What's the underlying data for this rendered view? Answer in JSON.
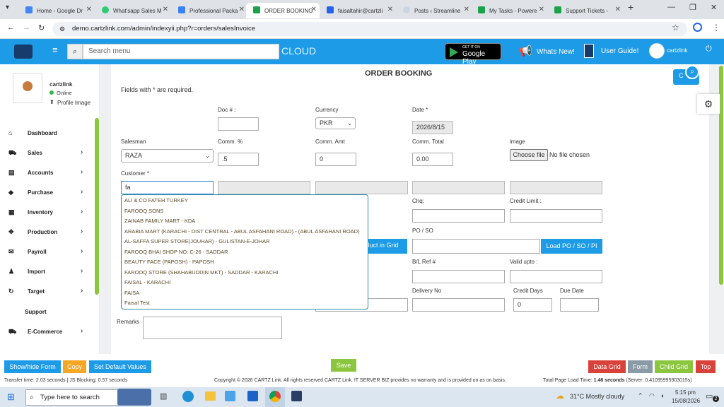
{
  "browser": {
    "tabs": [
      {
        "label": "Home - Google Dr",
        "color": "#4285f4"
      },
      {
        "label": "What'sapp Sales M",
        "color": "#2ecc71"
      },
      {
        "label": "Professional Packa",
        "color": "#3b82f6"
      },
      {
        "label": "ORDER BOOKING",
        "color": "#1aa34a"
      },
      {
        "label": "faisaltahir@cartzli",
        "color": "#2563eb"
      },
      {
        "label": "Posts ‹ Streamline",
        "color": "#e5e7eb"
      },
      {
        "label": "My Tasks - Powere",
        "color": "#1aa34a"
      },
      {
        "label": "Support Tickets -",
        "color": "#1aa34a"
      }
    ],
    "url": "demo.cartzlink.com/admin/indexyii.php?r=orders/salesInvoice"
  },
  "header": {
    "search_placeholder": "Search menu",
    "cloud_label": "CLOUD",
    "gplay_small": "GET IT ON",
    "gplay_big": "Google Play",
    "whats_new": "Whats New!",
    "user_guide": "User Guide!",
    "username": "cartzlink"
  },
  "profile": {
    "name": "cartzlink",
    "status": "Online",
    "profile_image": "Profile Image"
  },
  "sidebar": {
    "items": [
      {
        "label": "Dashboard",
        "icon": "home-icon",
        "glyph": "⌂",
        "arrow": false
      },
      {
        "label": "Sales",
        "icon": "cart-icon",
        "glyph": "🛒",
        "arrow": true
      },
      {
        "label": "Accounts",
        "icon": "bank-icon",
        "glyph": "▤",
        "arrow": true
      },
      {
        "label": "Purchase",
        "icon": "tag-icon",
        "glyph": "◆",
        "arrow": true
      },
      {
        "label": "Inventory",
        "icon": "grid-icon",
        "glyph": "▦",
        "arrow": true
      },
      {
        "label": "Production",
        "icon": "production-icon",
        "glyph": "✥",
        "arrow": true
      },
      {
        "label": "Payroll",
        "icon": "payroll-icon",
        "glyph": "✉",
        "arrow": true
      },
      {
        "label": "Import",
        "icon": "user-icon",
        "glyph": "♟",
        "arrow": true
      },
      {
        "label": "Target",
        "icon": "refresh-icon",
        "glyph": "↻",
        "arrow": true
      },
      {
        "label": "Support",
        "icon": "",
        "glyph": "",
        "arrow": false
      },
      {
        "label": "E-Commerce",
        "icon": "cart-icon",
        "glyph": "🛒",
        "arrow": true
      }
    ]
  },
  "form": {
    "title": "ORDER BOOKING",
    "required_note": "Fields with * are required.",
    "doc_label": "Doc # :",
    "doc_value": "",
    "currency_label": "Currency",
    "currency_value": "PKR",
    "date_label": "Date *",
    "date_value": "2026/8/15",
    "salesman_label": "Salesman",
    "salesman_value": "RAZA",
    "comm_pct_label": "Comm. %",
    "comm_pct_value": ".5",
    "comm_amt_label": "Comm. Amt",
    "comm_amt_value": "0",
    "comm_total_label": "Comm. Total",
    "comm_total_value": "0.00",
    "image_label": "image",
    "choose_file": "Choose file",
    "no_file": "No file chosen",
    "customer_label": "Customer *",
    "customer_value": "fa",
    "chq_label": "Chq:",
    "credit_limit_label": "Credit Limit :",
    "po_label": "PO / SO",
    "load_grid_btn": "oduct in Grid",
    "load_po_btn": "Load PO / SO / PI",
    "bl_ref_label": "B/L Ref #",
    "valid_upto_label": "Valid upto :",
    "delivery_label": "Delivery No",
    "credit_days_label": "Credit Days",
    "credit_days_value": "0",
    "due_date_label": "Due Date",
    "remarks_label": "Remarks"
  },
  "customer_suggestions": [
    "ALI & CO FATEH TURKEY",
    "FAROOQ SONS",
    "ZAINAB FAMILY MART - KDA",
    "ARABIA MART (KARACHI - DIST CENTRAL - ABUL ASFAHANI ROAD) - (ABUL ASFAHANI ROAD)",
    "AL-SAFFA SUPER STORE(JOUHAR) - GULISTAN-E-JOHAR",
    "FAROOQ BHAI SHOP NO: C-26 - SADDAR",
    "BEAUTY FACE (PAPOSH) - PAPOSH",
    "FAROOQ STORE (SHAHABUDDIN MKT) - SADDAR - KARACHI",
    "FAISAL - KARACHI",
    "FAISA",
    "Faisal Test"
  ],
  "bottom": {
    "showhide": "Show/hide Form",
    "copy": "Copy",
    "set_default": "Set Default Values",
    "save": "Save",
    "data_grid": "Data Grid",
    "form": "Form",
    "child_grid": "Child Grid",
    "top": "Top"
  },
  "footer": {
    "transfer": "Transfer time: 2.03 seconds | JS Blocking: 0.57 seconds",
    "copyright": "Copyright © 2026 CARTZ Link. All rights reserved CARTZ Link. IT SERVER BIZ provides no warranty and is provided on as on basis.",
    "load_prefix": "Total Page Load Time: ",
    "load_time": "1.46 seconds",
    "load_suffix": " (Server: 0.41095995903015s)"
  },
  "taskbar": {
    "search": "Type here to search",
    "weather": "31°C  Mostly cloudy",
    "time": "5:15 pm",
    "date": "15/08/2026",
    "notif_count": "2"
  },
  "colors": {
    "brand_blue": "#1e9be6",
    "save_green": "#8cc63f",
    "red": "#d9423a",
    "orange": "#f5a623",
    "gray": "#8a9aa6"
  }
}
